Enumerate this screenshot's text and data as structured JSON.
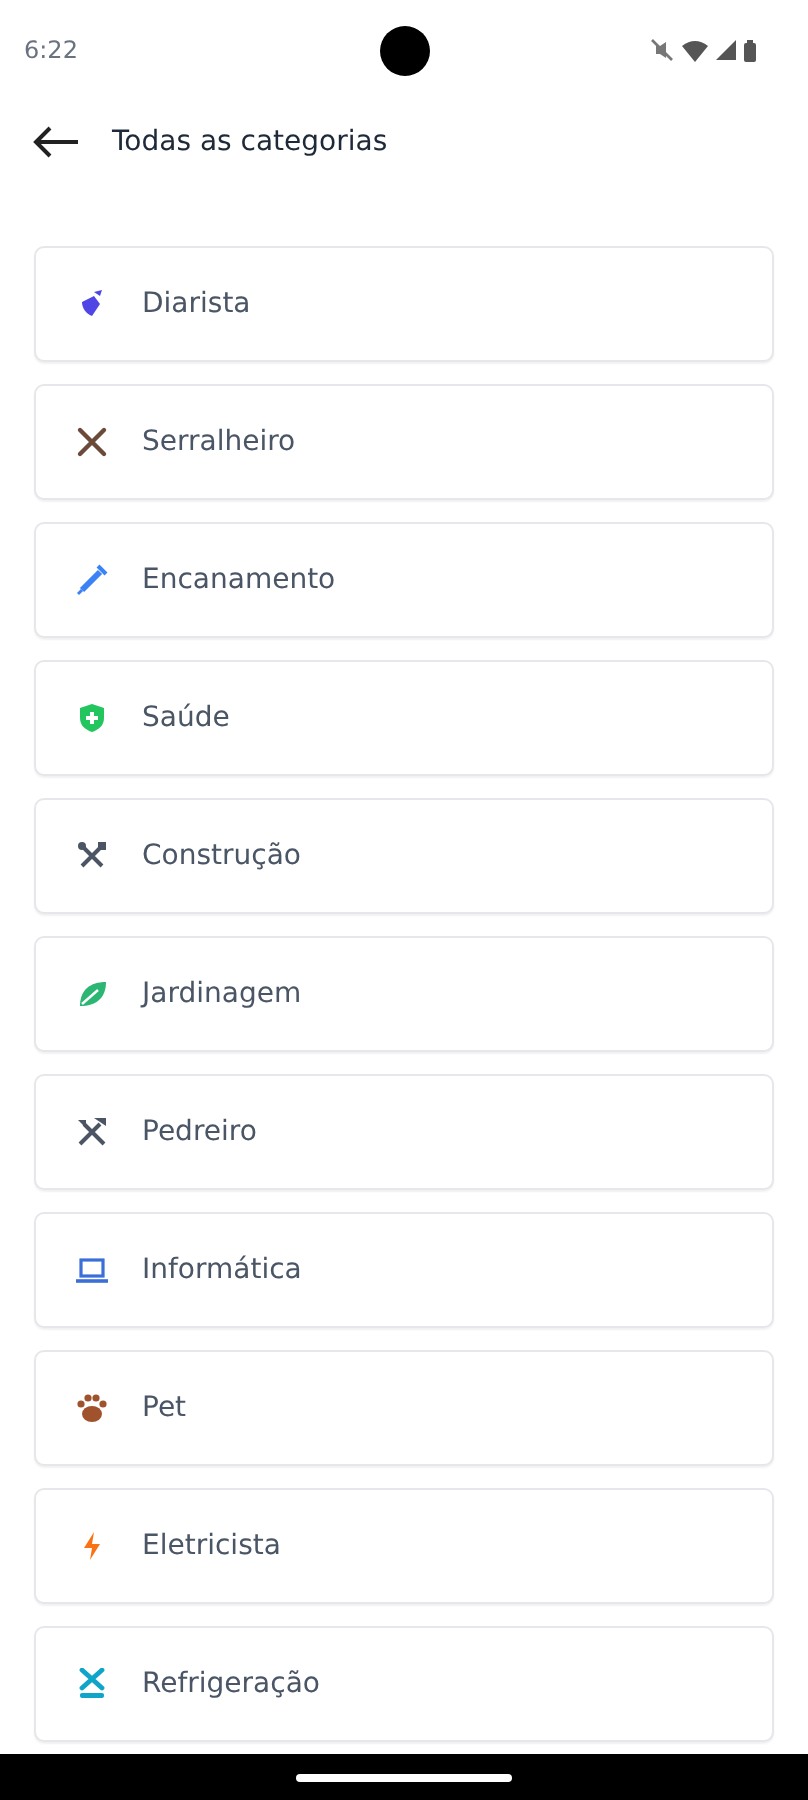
{
  "status_bar": {
    "time": "6:22"
  },
  "header": {
    "title": "Todas as categorias"
  },
  "categories": [
    {
      "label": "Diarista",
      "color": "#4f46e5"
    },
    {
      "label": "Serralheiro",
      "color": "#6b4a3a"
    },
    {
      "label": "Encanamento",
      "color": "#3b82f6"
    },
    {
      "label": "Saúde",
      "color": "#22c55e"
    },
    {
      "label": "Construção",
      "color": "#4b5563"
    },
    {
      "label": "Jardinagem",
      "color": "#2bb673"
    },
    {
      "label": "Pedreiro",
      "color": "#4b5563"
    },
    {
      "label": "Informática",
      "color": "#3b6fd8"
    },
    {
      "label": "Pet",
      "color": "#a0522d"
    },
    {
      "label": "Eletricista",
      "color": "#f97316"
    },
    {
      "label": "Refrigeração",
      "color": "#0ea5c9"
    }
  ]
}
